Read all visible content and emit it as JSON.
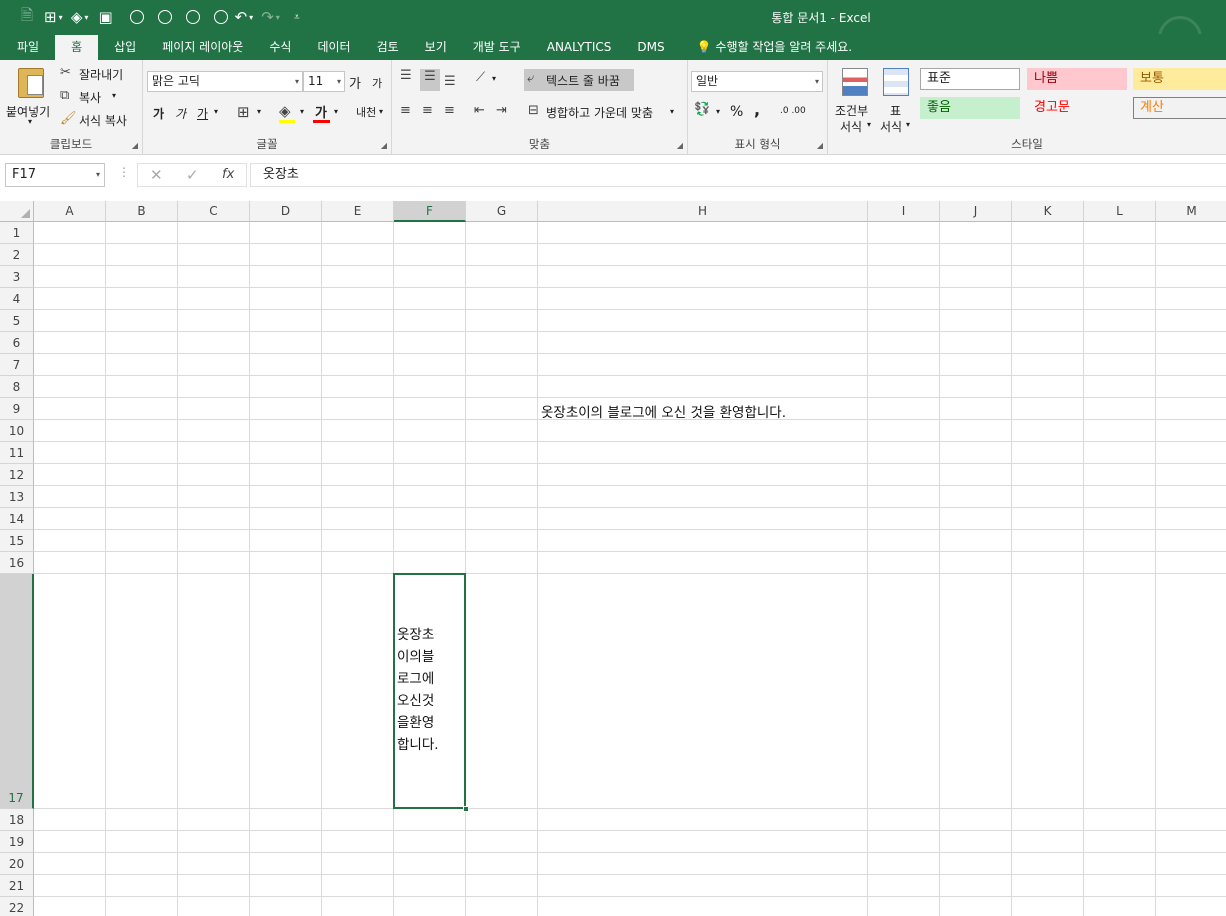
{
  "window": {
    "title": "통합 문서1 - Excel"
  },
  "tabs": [
    "파일",
    "홈",
    "삽입",
    "페이지 레이아웃",
    "수식",
    "데이터",
    "검토",
    "보기",
    "개발 도구",
    "ANALYTICS",
    "DMS"
  ],
  "tell_me": "수행할 작업을 알려 주세요.",
  "ribbon": {
    "clipboard": {
      "paste": "붙여넣기",
      "cut": "잘라내기",
      "copy": "복사",
      "format_painter": "서식 복사",
      "label": "클립보드"
    },
    "font": {
      "name": "맑은 고딕",
      "size": "11",
      "grow": "가",
      "shrink": "가",
      "bold": "가",
      "italic": "가",
      "underline": "가",
      "font_color": "가",
      "phonetic": "내천",
      "label": "글꼴"
    },
    "alignment": {
      "wrap_text": "텍스트 줄 바꿈",
      "merge_center": "병합하고 가운데 맞춤",
      "label": "맞춤"
    },
    "number": {
      "format": "일반",
      "percent": "%",
      "comma": ",",
      "inc_decimal": ".0 .00",
      "label": "표시 형식"
    },
    "styles": {
      "conditional_1": "조건부",
      "conditional_2": "서식",
      "table_1": "표",
      "table_2": "서식",
      "cells": [
        {
          "label": "표준",
          "bg": "#ffffff",
          "fg": "#222222",
          "border": "#a6a6a6"
        },
        {
          "label": "나쁨",
          "bg": "#ffc7ce",
          "fg": "#9c0006",
          "border": "#ffc7ce"
        },
        {
          "label": "보통",
          "bg": "#ffeb9c",
          "fg": "#9c5700",
          "border": "#ffeb9c"
        },
        {
          "label": "좋음",
          "bg": "#c6efce",
          "fg": "#006100",
          "border": "#c6efce"
        },
        {
          "label": "경고문",
          "bg": "#f3f3f3",
          "fg": "#ff0000",
          "border": "#f3f3f3"
        },
        {
          "label": "계산",
          "bg": "#f2f2f2",
          "fg": "#fa7d00",
          "border": "#7f7f7f"
        }
      ],
      "label": "스타일"
    }
  },
  "formula_bar": {
    "name_box": "F17",
    "fx": "fx",
    "cancel": "✕",
    "enter": "✓",
    "value": "옷장초"
  },
  "columns": [
    "A",
    "B",
    "C",
    "D",
    "E",
    "F",
    "G",
    "H",
    "I",
    "J",
    "K",
    "L",
    "M"
  ],
  "rows": [
    "1",
    "2",
    "3",
    "4",
    "5",
    "6",
    "7",
    "8",
    "9",
    "10",
    "11",
    "12",
    "13",
    "14",
    "15",
    "16",
    "17",
    "18",
    "19",
    "20",
    "21",
    "22"
  ],
  "cells": {
    "H9": "옷장초이의 블로그에 오신 것을 환영합니다.",
    "F17": "옷장초\n이의블\n로그에\n오신것\n을환영\n합니다."
  },
  "colors": {
    "accent": "#217346",
    "ribbon_bg": "#f3f3f3"
  }
}
